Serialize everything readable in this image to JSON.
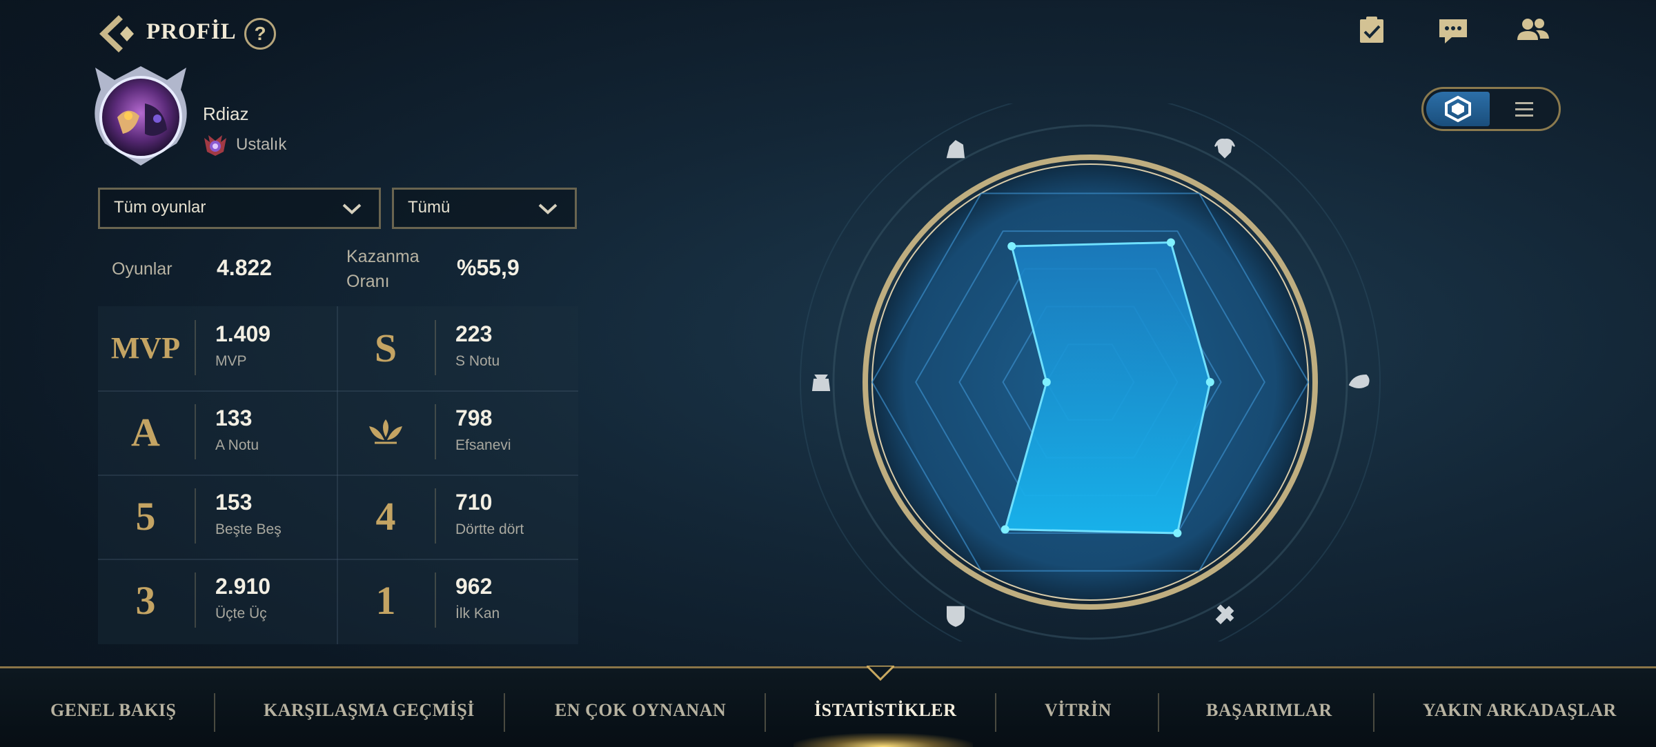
{
  "header": {
    "title": "PROFİL",
    "help": "?"
  },
  "player": {
    "name": "Rdiaz",
    "rank": "Ustalık"
  },
  "filters": {
    "mode": "Tüm oyunlar",
    "role": "Tümü"
  },
  "summary": {
    "games_label": "Oyunlar",
    "games_value": "4.822",
    "winrate_label_1": "Kazanma",
    "winrate_label_2": "Oranı",
    "winrate_value": "%55,9"
  },
  "stats": [
    {
      "emblem": "MVP",
      "value": "1.409",
      "label": "MVP"
    },
    {
      "emblem": "S",
      "value": "223",
      "label": "S Notu"
    },
    {
      "emblem": "A",
      "value": "133",
      "label": "A Notu"
    },
    {
      "emblem": "legendary-icon",
      "value": "798",
      "label": "Efsanevi"
    },
    {
      "emblem": "5",
      "value": "153",
      "label": "Beşte Beş"
    },
    {
      "emblem": "4",
      "value": "710",
      "label": "Dörtte dört"
    },
    {
      "emblem": "3",
      "value": "2.910",
      "label": "Üçte Üç"
    },
    {
      "emblem": "1",
      "value": "962",
      "label": "İlk Kan"
    }
  ],
  "radar": {
    "axes": [
      "fighter-icon",
      "mage-icon",
      "support-icon",
      "marksman-icon",
      "tank-icon",
      "assassin-icon"
    ],
    "values": [
      0.72,
      0.74,
      0.55,
      0.8,
      0.78,
      0.2
    ]
  },
  "nav": {
    "items": [
      "GENEL BAKIŞ",
      "KARŞILAŞMA GEÇMİŞİ",
      "EN ÇOK OYNANAN",
      "İSTATİSTİKLER",
      "VİTRİN",
      "BAŞARIMLAR",
      "YAKIN ARKADAŞLAR"
    ],
    "active": "İSTATİSTİKLER"
  },
  "colors": {
    "accent": "#c4a463",
    "radar_fill": "#1fa6e6",
    "radar_stroke": "#6fe0ff"
  }
}
